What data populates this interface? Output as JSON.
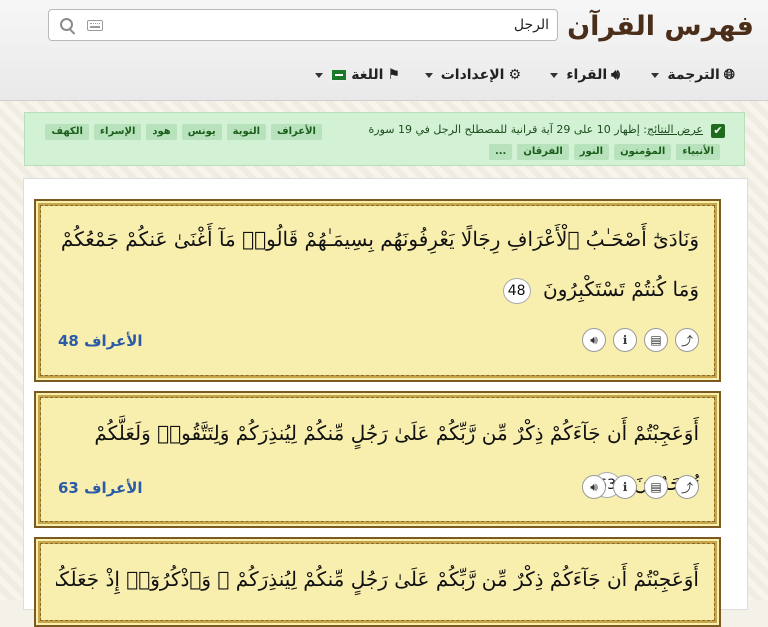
{
  "header": {
    "logo_text": "فهرس القرآن",
    "search": {
      "value": "الرجل",
      "placeholder": ""
    },
    "menus": [
      {
        "label": "الترجمة",
        "icon": "globe-icon"
      },
      {
        "label": "القراء",
        "icon": "speaker-icon"
      },
      {
        "label": "الإعدادات",
        "icon": "gear-icon"
      },
      {
        "label": "اللغة",
        "icon": "flag-icon"
      }
    ]
  },
  "results": {
    "prefix": "عرض النتائج",
    "summary": ": إظهار 10 على 29 آية قرانية للمصطلح الرجل في 19 سورة",
    "tags_row1": [
      "الأعراف",
      "التوبة",
      "يونس",
      "هود",
      "الإسراء",
      "الكهف"
    ],
    "tags_row2": [
      "الأنبياء",
      "المؤمنون",
      "النور",
      "الفرقان",
      "..."
    ]
  },
  "verses": [
    {
      "text": "وَنَادَىٰٓ أَصْحَـٰبُ ٱلْأَعْرَافِ رِجَالًا يَعْرِفُونَهُم بِسِيمَـٰهُمْ قَالُوا۟ مَآ أَغْنَىٰ عَنكُمْ جَمْعُكُمْ وَمَا كُنتُمْ تَسْتَكْبِرُونَ",
      "number": "48",
      "reference": "الأعراف 48"
    },
    {
      "text": "أَوَعَجِبْتُمْ أَن جَآءَكُمْ ذِكْرٌ مِّن رَّبِّكُمْ عَلَىٰ رَجُلٍ مِّنكُمْ لِيُنذِرَكُمْ وَلِتَتَّقُوا۟ وَلَعَلَّكُمْ تُرْحَمُونَ",
      "number": "63",
      "reference": "الأعراف 63"
    },
    {
      "text": "أَوَعَجِبْتُمْ أَن جَآءَكُمْ ذِكْرٌ مِّن رَّبِّكُمْ عَلَىٰ رَجُلٍ مِّنكُمْ لِيُنذِرَكُمْ ۚ وَٱذْكُرُوٓا۟ إِذْ جَعَلَكُمْ خُلَفَآءَ",
      "number": "",
      "reference": ""
    }
  ],
  "colors": {
    "card_bg": "#f8eeae",
    "card_border": "#7a5a20",
    "link": "#2a5aa8",
    "info_bg": "#d3f2d5"
  }
}
